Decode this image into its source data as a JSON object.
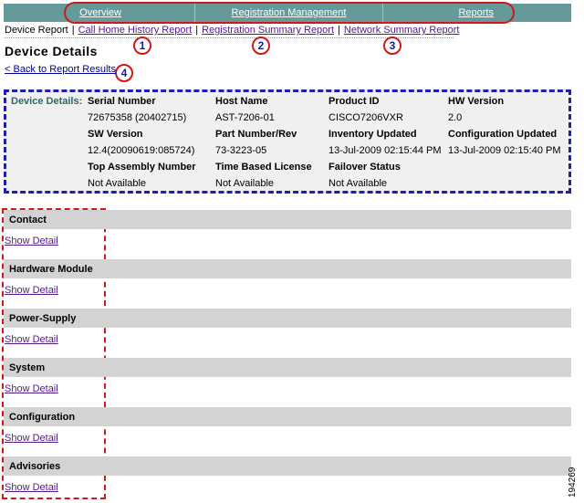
{
  "topnav": {
    "items": [
      "Overview",
      "Registration Management",
      "Reports"
    ]
  },
  "subnav": {
    "current": "Device Report",
    "links": [
      "Call Home History Report",
      "Registration Summary Report",
      "Network Summary Report"
    ]
  },
  "callouts": [
    "1",
    "2",
    "3",
    "4"
  ],
  "page_title": "Device Details",
  "back_link": "< Back to Report Results",
  "details": {
    "label": "Device Details:",
    "rows": [
      [
        {
          "h": "Serial Number",
          "v": "72675358 (20402715)"
        },
        {
          "h": "Host Name",
          "v": "AST-7206-01"
        },
        {
          "h": "Product ID",
          "v": "CISCO7206VXR"
        },
        {
          "h": "HW Version",
          "v": "2.0"
        }
      ],
      [
        {
          "h": "SW Version",
          "v": "12.4(20090619:085724)"
        },
        {
          "h": "Part Number/Rev",
          "v": "73-3223-05"
        },
        {
          "h": "Inventory Updated",
          "v": "13-Jul-2009 02:15:44 PM"
        },
        {
          "h": "Configuration Updated",
          "v": "13-Jul-2009 02:15:40 PM"
        }
      ],
      [
        {
          "h": "Top Assembly Number",
          "v": "Not Available"
        },
        {
          "h": "Time Based License",
          "v": "Not Available"
        },
        {
          "h": "Failover Status",
          "v": "Not Available"
        }
      ]
    ]
  },
  "sections": [
    {
      "title": "Contact",
      "link": "Show Detail"
    },
    {
      "title": "Hardware Module",
      "link": "Show Detail"
    },
    {
      "title": "Power-Supply",
      "link": "Show Detail"
    },
    {
      "title": "System",
      "link": "Show Detail"
    },
    {
      "title": "Configuration",
      "link": "Show Detail"
    },
    {
      "title": "Advisories",
      "link": "Show Detail"
    }
  ],
  "figure_number": "194269"
}
